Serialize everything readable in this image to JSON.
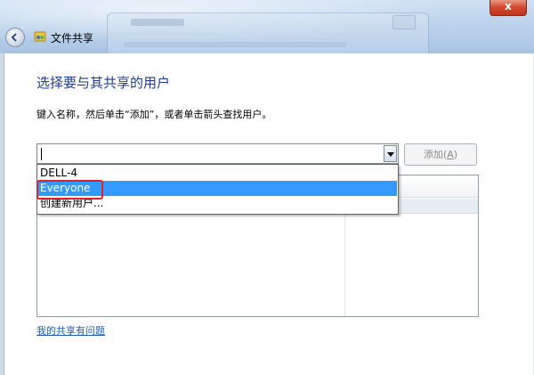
{
  "window": {
    "title": "文件共享",
    "close_label": "x"
  },
  "dialog": {
    "heading": "选择要与其共享的用户",
    "instruction": "键入名称，然后单击“添加”，或者单击箭头查找用户。",
    "combo_value": "",
    "add_button": {
      "label": "添加(",
      "accelerator": "A",
      "suffix": ")"
    },
    "dropdown_options": [
      "DELL-4",
      "Everyone",
      "创建新用户..."
    ],
    "selected_option": "Everyone",
    "help_link": "我的共享有问题"
  },
  "colors": {
    "heading": "#1e3d8f",
    "selection": "#3399ff",
    "highlight_box": "#e0202a",
    "link": "#1a5fb4"
  },
  "icons": {
    "back": "back-arrow-icon",
    "title": "file-sharing-icon",
    "dropdown": "chevron-down-icon"
  }
}
